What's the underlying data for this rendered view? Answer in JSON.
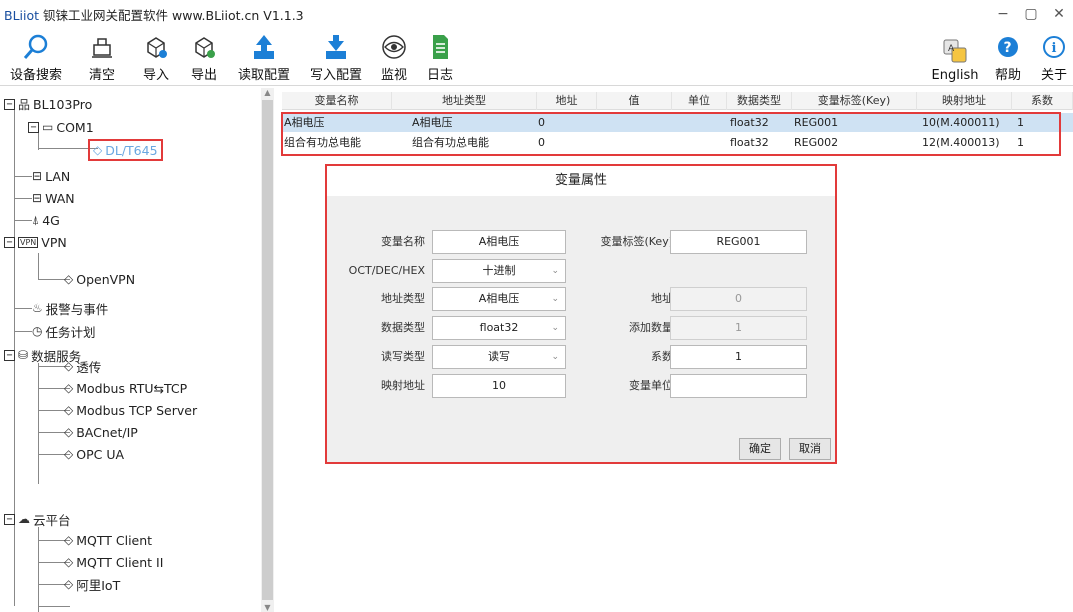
{
  "window": {
    "title_brand": "BLiiot",
    "title_rest": " 钡铼工业网关配置软件 www.BLiiot.cn V1.1.3",
    "min": "−",
    "max": "▢",
    "close": "✕"
  },
  "toolbar": {
    "search": "设备搜索",
    "clear": "清空",
    "import": "导入",
    "export": "导出",
    "read_config": "读取配置",
    "write_config": "写入配置",
    "monitor": "监视",
    "log": "日志",
    "english": "English",
    "help": "帮助",
    "about": "关于"
  },
  "tree": {
    "root": "BL103Pro",
    "com1": "COM1",
    "dlt645": "DL/T645",
    "lan": "LAN",
    "wan": "WAN",
    "g4": "4G",
    "vpn": "VPN",
    "openvpn": "OpenVPN",
    "alarm": "报警与事件",
    "task": "任务计划",
    "data_service": "数据服务",
    "transparent": "透传",
    "modbus_rtu_tcp": "Modbus RTU⇆TCP",
    "modbus_tcp_server": "Modbus TCP Server",
    "bacnet": "BACnet/IP",
    "opcua": "OPC UA",
    "cloud": "云平台",
    "mqtt1": "MQTT Client",
    "mqtt2": "MQTT Client II",
    "aliyun": "阿里IoT"
  },
  "grid": {
    "headers": [
      "变量名称",
      "地址类型",
      "地址",
      "值",
      "单位",
      "数据类型",
      "变量标签(Key)",
      "映射地址",
      "系数"
    ],
    "rows": [
      [
        "A相电压",
        "A相电压",
        "0",
        "",
        "",
        "float32",
        "REG001",
        "10(M.400011)",
        "1"
      ],
      [
        "组合有功总电能",
        "组合有功总电能",
        "0",
        "",
        "",
        "float32",
        "REG002",
        "12(M.400013)",
        "1"
      ]
    ]
  },
  "dialog": {
    "title": "变量属性",
    "var_name_label": "变量名称",
    "var_name": "A相电压",
    "key_label": "变量标签(Key)",
    "key": "REG001",
    "radix_label": "OCT/DEC/HEX",
    "radix": "十进制",
    "addr_type_label": "地址类型",
    "addr_type": "A相电压",
    "addr_label": "地址",
    "addr": "0",
    "data_type_label": "数据类型",
    "data_type": "float32",
    "add_count_label": "添加数量",
    "add_count": "1",
    "rw_label": "读写类型",
    "rw": "读写",
    "coef_label": "系数",
    "coef": "1",
    "map_label": "映射地址",
    "map": "10",
    "unit_label": "变量单位",
    "unit": "",
    "ok": "确定",
    "cancel": "取消"
  }
}
